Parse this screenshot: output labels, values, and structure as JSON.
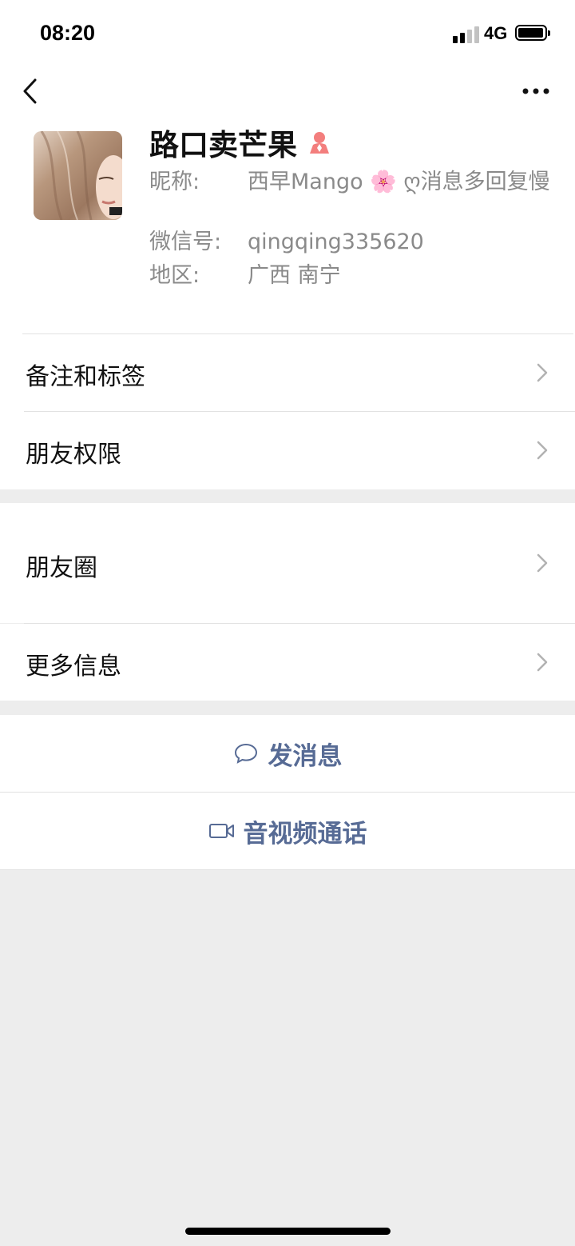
{
  "status_bar": {
    "time": "08:20",
    "network": "4G",
    "signal_bars_filled": 2,
    "signal_bars_total": 4,
    "battery_level": 0.9
  },
  "nav": {
    "back_icon": "chevron-left-icon",
    "more_icon": "ellipsis-icon"
  },
  "profile": {
    "name": "路口卖芒果",
    "gender_icon": "female-icon",
    "nickname_label": "昵称:",
    "nickname_value": "西早Mango 🌸 ღ消息多回复慢",
    "wechat_id_label": "微信号:",
    "wechat_id_value": "qingqing335620",
    "region_label": "地区:",
    "region_value": "广西 南宁"
  },
  "menu": {
    "remarks_tags": "备注和标签",
    "friend_permissions": "朋友权限",
    "moments": "朋友圈",
    "more_info": "更多信息"
  },
  "actions": {
    "send_message": "发消息",
    "send_message_icon": "chat-bubble-icon",
    "video_call": "音视频通话",
    "video_call_icon": "video-camera-icon"
  },
  "colors": {
    "link_blue": "#576b95",
    "background": "#ededed",
    "gender_pink": "#f37e7d"
  }
}
